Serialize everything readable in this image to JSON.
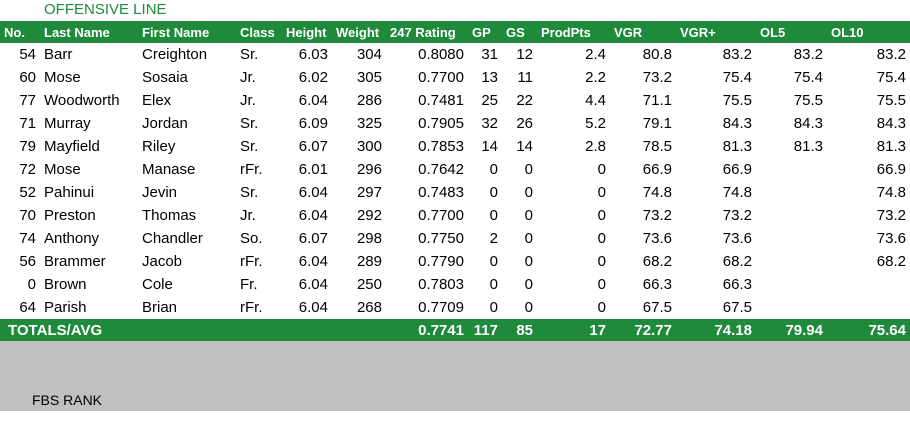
{
  "section_title": "OFFENSIVE LINE",
  "headers": [
    "No.",
    "Last Name",
    "First Name",
    "Class",
    "Height",
    "Weight",
    "247 Rating",
    "GP",
    "GS",
    "ProdPts",
    "VGR",
    "VGR+",
    "OL5",
    "OL10"
  ],
  "rows": [
    [
      "54",
      "Barr",
      "Creighton",
      "Sr.",
      "6.03",
      "304",
      "0.8080",
      "31",
      "12",
      "2.4",
      "80.8",
      "83.2",
      "83.2",
      "83.2"
    ],
    [
      "60",
      "Mose",
      "Sosaia",
      "Jr.",
      "6.02",
      "305",
      "0.7700",
      "13",
      "11",
      "2.2",
      "73.2",
      "75.4",
      "75.4",
      "75.4"
    ],
    [
      "77",
      "Woodworth",
      "Elex",
      "Jr.",
      "6.04",
      "286",
      "0.7481",
      "25",
      "22",
      "4.4",
      "71.1",
      "75.5",
      "75.5",
      "75.5"
    ],
    [
      "71",
      "Murray",
      "Jordan",
      "Sr.",
      "6.09",
      "325",
      "0.7905",
      "32",
      "26",
      "5.2",
      "79.1",
      "84.3",
      "84.3",
      "84.3"
    ],
    [
      "79",
      "Mayfield",
      "Riley",
      "Sr.",
      "6.07",
      "300",
      "0.7853",
      "14",
      "14",
      "2.8",
      "78.5",
      "81.3",
      "81.3",
      "81.3"
    ],
    [
      "72",
      "Mose",
      "Manase",
      "rFr.",
      "6.01",
      "296",
      "0.7642",
      "0",
      "0",
      "0",
      "66.9",
      "66.9",
      "",
      "66.9"
    ],
    [
      "52",
      "Pahinui",
      "Jevin",
      "Sr.",
      "6.04",
      "297",
      "0.7483",
      "0",
      "0",
      "0",
      "74.8",
      "74.8",
      "",
      "74.8"
    ],
    [
      "70",
      "Preston",
      "Thomas",
      "Jr.",
      "6.04",
      "292",
      "0.7700",
      "0",
      "0",
      "0",
      "73.2",
      "73.2",
      "",
      "73.2"
    ],
    [
      "74",
      "Anthony",
      "Chandler",
      "So.",
      "6.07",
      "298",
      "0.7750",
      "2",
      "0",
      "0",
      "73.6",
      "73.6",
      "",
      "73.6"
    ],
    [
      "56",
      "Brammer",
      "Jacob",
      "rFr.",
      "6.04",
      "289",
      "0.7790",
      "0",
      "0",
      "0",
      "68.2",
      "68.2",
      "",
      "68.2"
    ],
    [
      "0",
      "Brown",
      "Cole",
      "Fr.",
      "6.04",
      "250",
      "0.7803",
      "0",
      "0",
      "0",
      "66.3",
      "66.3",
      "",
      ""
    ],
    [
      "64",
      "Parish",
      "Brian",
      "rFr.",
      "6.04",
      "268",
      "0.7709",
      "0",
      "0",
      "0",
      "67.5",
      "67.5",
      "",
      ""
    ]
  ],
  "totals": {
    "label": "TOTALS/AVG",
    "rating": "0.7741",
    "gp": "117",
    "gs": "85",
    "prodpts": "17",
    "vgr": "72.77",
    "vgr_plus": "74.18",
    "ol5": "79.94",
    "ol10": "75.64"
  },
  "fbs_rank_label": "FBS RANK",
  "colors": {
    "accent": "#1f8a3b",
    "band": "#c0c0c0"
  }
}
